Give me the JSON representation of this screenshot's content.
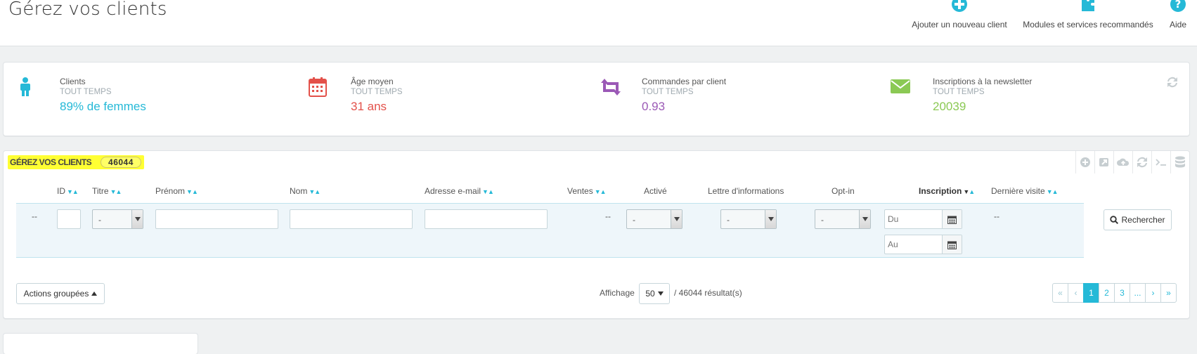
{
  "page": {
    "title": "Gérez vos clients",
    "toolbar": [
      {
        "label": "Ajouter un nouveau client",
        "icon": "plus-circle-icon"
      },
      {
        "label": "Modules et services recommandés",
        "icon": "puzzle-icon"
      },
      {
        "label": "Aide",
        "icon": "help-icon"
      }
    ]
  },
  "kpis": [
    {
      "title": "Clients",
      "subtitle": "TOUT TEMPS",
      "value": "89% de femmes",
      "color": "#25b9d7",
      "icon": "user-icon"
    },
    {
      "title": "Âge moyen",
      "subtitle": "TOUT TEMPS",
      "value": "31 ans",
      "color": "#e3514a",
      "icon": "calendar-icon"
    },
    {
      "title": "Commandes par client",
      "subtitle": "TOUT TEMPS",
      "value": "0.93",
      "color": "#9b59b6",
      "icon": "retweet-icon"
    },
    {
      "title": "Inscriptions à la newsletter",
      "subtitle": "TOUT TEMPS",
      "value": "20039",
      "color": "#8bc954",
      "icon": "envelope-icon"
    }
  ],
  "list": {
    "title": "Gérez vos clients",
    "count": "46044",
    "columns": {
      "id": "ID",
      "title": "Titre",
      "firstname": "Prénom",
      "lastname": "Nom",
      "email": "Adresse e-mail",
      "sales": "Ventes",
      "active": "Activé",
      "newsletter": "Lettre d'informations",
      "optin": "Opt-in",
      "date_add": "Inscription",
      "last_visit": "Dernière visite"
    },
    "filters": {
      "dash": "--",
      "select_value": "-",
      "date_from_placeholder": "Du",
      "date_to_placeholder": "Au",
      "search_label": "Rechercher"
    }
  },
  "footer": {
    "bulk_actions": "Actions groupées",
    "display_label": "Affichage",
    "per_page": "50",
    "results": "/ 46044 résultat(s)",
    "pages": [
      "«",
      "‹",
      "1",
      "2",
      "3",
      "...",
      "›",
      "»"
    ],
    "active_page": "1"
  },
  "colors": {
    "accent": "#25b9d7",
    "highlight": "#ffff33"
  }
}
